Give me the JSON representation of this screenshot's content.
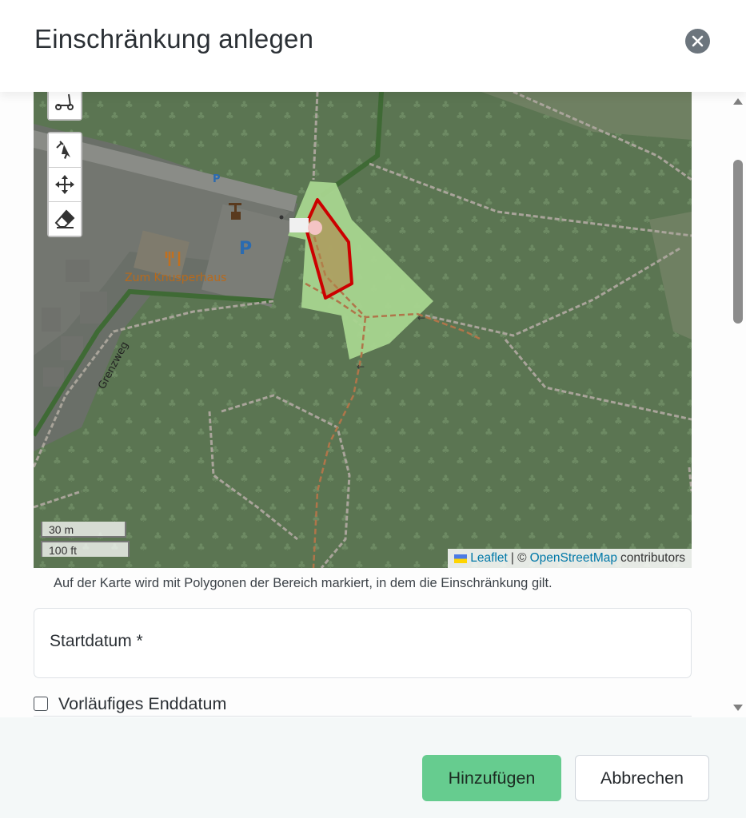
{
  "modal": {
    "title": "Einschränkung anlegen",
    "close_icon": "close-icon"
  },
  "map": {
    "labels": {
      "restaurant": "Zum Knusperhaus",
      "street": "Grenzweg",
      "parking_big": "P",
      "parking_small": "P"
    },
    "tools": {
      "top_icon": "scooter-icon",
      "edit_icon": "edit-pointer-icon",
      "move_icon": "move-icon",
      "erase_icon": "eraser-icon"
    },
    "scale": {
      "metric": "30 m",
      "imperial": "100 ft"
    },
    "attribution": {
      "leaflet": "Leaflet",
      "separator": "| ©",
      "osm": "OpenStreetMap",
      "suffix": "contributors"
    },
    "colors": {
      "forest": "#5b7552",
      "highlight": "#a8d58f",
      "polygon_stroke": "#cc0000"
    }
  },
  "form": {
    "help_text": "Auf der Karte wird mit Polygonen der Bereich markiert, in dem die Einschränkung gilt.",
    "start_date_label": "Startdatum *",
    "provisional_end_label": "Vorläufiges Enddatum",
    "provisional_end_checked": false
  },
  "footer": {
    "add_label": "Hinzufügen",
    "cancel_label": "Abbrechen",
    "add_color": "#66cc8f"
  }
}
